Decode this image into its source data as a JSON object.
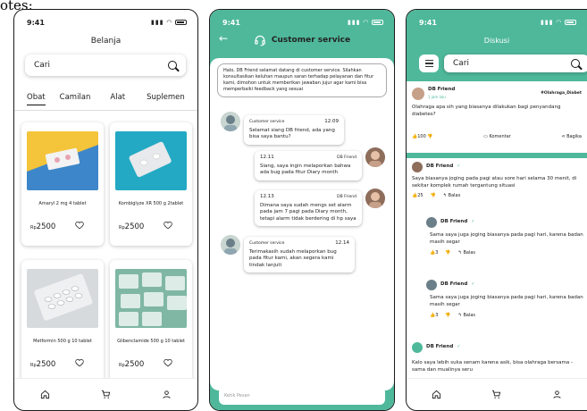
{
  "caption": "otes:",
  "status": {
    "time": "9:41"
  },
  "shop": {
    "title": "Belanja",
    "search_placeholder": "Cari",
    "tabs": [
      "Obat",
      "Camilan",
      "Alat",
      "Suplemen"
    ],
    "products": [
      {
        "name": "Amaryl 2 mg 4 tablet",
        "currency": "Rp",
        "price": "2500"
      },
      {
        "name": "Kombiglyze XR 500 g 2tablet",
        "currency": "Rp",
        "price": "2500"
      },
      {
        "name": "Metformin 500 g 10 tablet",
        "currency": "Rp",
        "price": "2500"
      },
      {
        "name": "Glibenclamide 500 g 10 tablet",
        "currency": "Rp",
        "price": "2500"
      }
    ]
  },
  "chat": {
    "title": "Customer service",
    "intro": "Halo, DB Friend selamat datang di customer service. Silahkan konsultasikan keluhan maupun saran terhadap pelayanan dan fitur kami, dimohon untuk memberikan jawaban jujur agar kami bisa memperbaiki feedback yang sesuai",
    "messages": [
      {
        "sender": "Customer service",
        "time": "12.09",
        "text": "Selamat siang DB friend, ada yang bisa saya bantu?"
      },
      {
        "sender": "DB Friend",
        "time": "12.11",
        "text": "Siang, saya ingin melaporkan bahwa ada bug pada fitur Diary month"
      },
      {
        "sender": "DB Friend",
        "time": "12.13",
        "text": "Dimana saya sudah mengs set alarm pada jam 7 pagi pada Diary month, tetapi alarm tidak berdering di hp saya"
      },
      {
        "sender": "Customer service",
        "time": "12.14",
        "text": "Terimakasih sudah melaporkan bug pada fitur kami, akan segera kami tindak lanjuti"
      }
    ],
    "input_placeholder": "Ketik Pesan"
  },
  "forum": {
    "title": "Diskusi",
    "search_placeholder": "Cari",
    "post": {
      "user": "DB Friend",
      "sub": "1 jam lalu",
      "tag": "#Olahraga_Diabet",
      "text": "Olahraga apa sih yang biasanya dilakukan bagi penyandang diabetes?",
      "likes": "100",
      "comment_label": "Komentar",
      "share_label": "Bagika"
    },
    "replies": [
      {
        "user": "DB Friend",
        "text": "Saya biasanya joging pada pagi atau sore hari selama 30 menit, di sekitar komplek rumah tergantung situasi",
        "likes": "25",
        "reply_label": "Balas"
      },
      {
        "user": "DB Friend",
        "text": "Sama saya juga joging biasanya pada pagi hari, karena badan masih segar",
        "likes": "3",
        "reply_label": "Balas"
      },
      {
        "user": "DB Friend",
        "text": "Sama saya juga joging biasanya pada pagi hari, karena badan masih segar",
        "likes": "3",
        "reply_label": "Balas"
      },
      {
        "user": "DB Friend",
        "text": "Kalo saya lebih suka senam karena asik, bisa olahraga bersama - sama dan mualinya seru"
      }
    ]
  },
  "colors": {
    "accent": "#4fb89b"
  },
  "icons": [
    "home-icon",
    "cart-icon",
    "profile-icon",
    "search-icon",
    "heart-icon",
    "back-arrow-icon",
    "headset-icon",
    "menu-icon",
    "thumb-up-icon",
    "thumb-down-icon",
    "comment-icon",
    "share-icon",
    "reply-icon"
  ]
}
